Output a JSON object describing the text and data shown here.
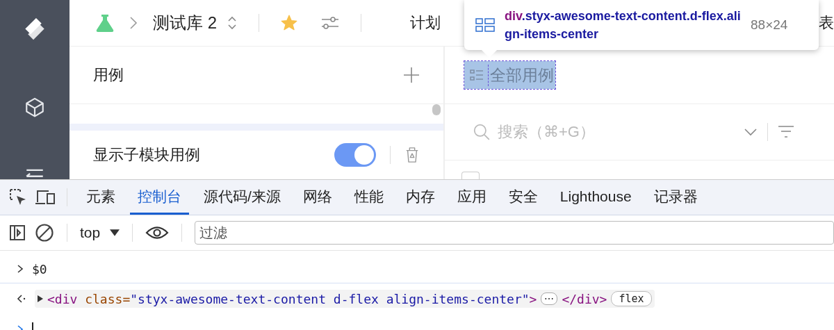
{
  "topbar": {
    "breadcrumb": "测试库 2",
    "starred": true,
    "nav": [
      "计划",
      "表"
    ]
  },
  "tooltip": {
    "tag": "div",
    "classes": ".styx-awesome-text-content.d-flex.align-items-center",
    "size": "88×24"
  },
  "left_panel": {
    "title": "用例",
    "toggle": {
      "label": "显示子模块用例",
      "on": true
    }
  },
  "right_panel": {
    "heading": "全部用例",
    "search": {
      "placeholder": "搜索（⌘+G）"
    },
    "row_checkbox": {
      "checked": false
    }
  },
  "devtools": {
    "tabs": [
      {
        "label": "元素",
        "selected": false
      },
      {
        "label": "控制台",
        "selected": true
      },
      {
        "label": "源代码/来源",
        "selected": false
      },
      {
        "label": "网络",
        "selected": false
      },
      {
        "label": "性能",
        "selected": false
      },
      {
        "label": "内存",
        "selected": false
      },
      {
        "label": "应用",
        "selected": false
      },
      {
        "label": "安全",
        "selected": false
      },
      {
        "label": "Lighthouse",
        "selected": false
      },
      {
        "label": "记录器",
        "selected": false
      }
    ],
    "context": "top",
    "filter": {
      "placeholder": "过滤"
    },
    "console": [
      {
        "kind": "input",
        "text": "$0"
      },
      {
        "kind": "output",
        "parts": [
          {
            "kind": "tag",
            "text": "<div"
          },
          {
            "kind": "attr",
            "text": " class="
          },
          {
            "kind": "value",
            "text": "\"styx-awesome-text-content d-flex align-items-center\""
          },
          {
            "kind": "tag",
            "text": ">"
          }
        ],
        "ellipsis": "⋯",
        "end": "</div>",
        "badge": "flex"
      }
    ]
  }
}
